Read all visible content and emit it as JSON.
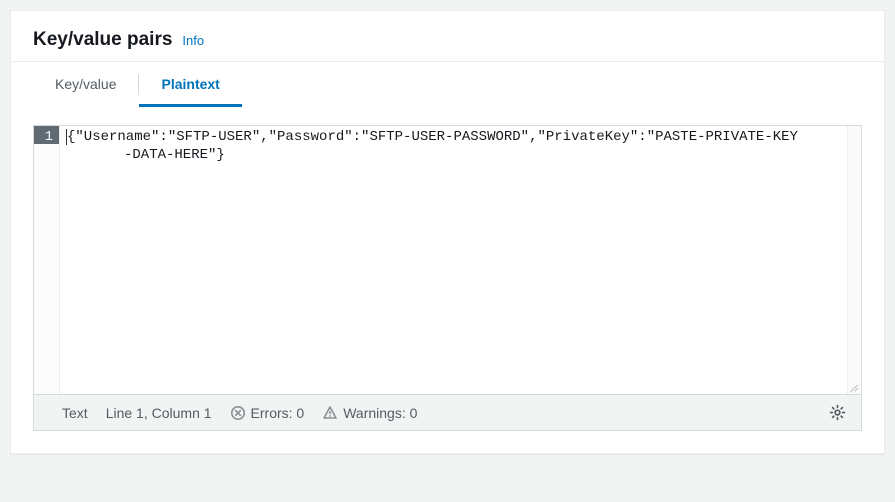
{
  "header": {
    "title": "Key/value pairs",
    "info_label": "Info"
  },
  "tabs": {
    "key_value": "Key/value",
    "plaintext": "Plaintext"
  },
  "editor": {
    "line_number": "1",
    "content_line1": "{\"Username\":\"SFTP-USER\",\"Password\":\"SFTP-USER-PASSWORD\",\"PrivateKey\":\"PASTE-PRIVATE-KEY",
    "content_line2": "-DATA-HERE\"}"
  },
  "status": {
    "mode": "Text",
    "position": "Line 1, Column 1",
    "errors_label": "Errors: 0",
    "warnings_label": "Warnings: 0"
  }
}
